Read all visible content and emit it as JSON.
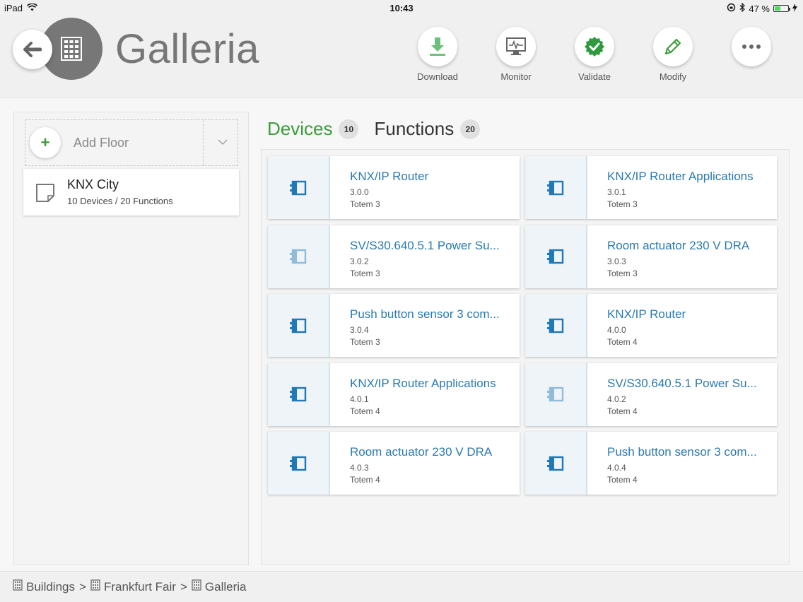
{
  "status_bar": {
    "device": "iPad",
    "time": "10:43",
    "battery_percent": "47 %",
    "battery_level": 0.47
  },
  "header": {
    "title": "Galleria",
    "tools": [
      {
        "label": "Download",
        "icon": "download-icon"
      },
      {
        "label": "Monitor",
        "icon": "monitor-icon"
      },
      {
        "label": "Validate",
        "icon": "validate-check-icon"
      },
      {
        "label": "Modify",
        "icon": "pencil-icon"
      },
      {
        "label": "",
        "icon": "more-icon"
      }
    ]
  },
  "sidebar": {
    "add_floor_label": "Add Floor",
    "floor": {
      "name": "KNX City",
      "summary": "10 Devices / 20 Functions"
    }
  },
  "tabs": [
    {
      "label": "Devices",
      "count": "10",
      "active": true
    },
    {
      "label": "Functions",
      "count": "20",
      "active": false
    }
  ],
  "devices": [
    {
      "name": "KNX/IP Router",
      "address": "3.0.0",
      "line": "Totem 3",
      "faded": false
    },
    {
      "name": "KNX/IP Router Applications",
      "address": "3.0.1",
      "line": "Totem 3",
      "faded": false
    },
    {
      "name": "SV/S30.640.5.1 Power Su...",
      "address": "3.0.2",
      "line": "Totem 3",
      "faded": true
    },
    {
      "name": "Room actuator 230 V DRA",
      "address": "3.0.3",
      "line": "Totem 3",
      "faded": false
    },
    {
      "name": "Push button sensor 3 com...",
      "address": "3.0.4",
      "line": "Totem 3",
      "faded": false
    },
    {
      "name": "KNX/IP Router",
      "address": "4.0.0",
      "line": "Totem 4",
      "faded": false
    },
    {
      "name": "KNX/IP Router Applications",
      "address": "4.0.1",
      "line": "Totem 4",
      "faded": false
    },
    {
      "name": "SV/S30.640.5.1 Power Su...",
      "address": "4.0.2",
      "line": "Totem 4",
      "faded": true
    },
    {
      "name": "Room actuator 230 V DRA",
      "address": "4.0.3",
      "line": "Totem 4",
      "faded": false
    },
    {
      "name": "Push button sensor 3 com...",
      "address": "4.0.4",
      "line": "Totem 4",
      "faded": false
    }
  ],
  "breadcrumb": [
    "Buildings",
    "Frankfurt Fair",
    "Galleria"
  ],
  "breadcrumb_separator": ">",
  "colors": {
    "accent_green": "#3a9d3a",
    "device_blue": "#2a7ab0",
    "icon_blue": "#1f78b8"
  }
}
